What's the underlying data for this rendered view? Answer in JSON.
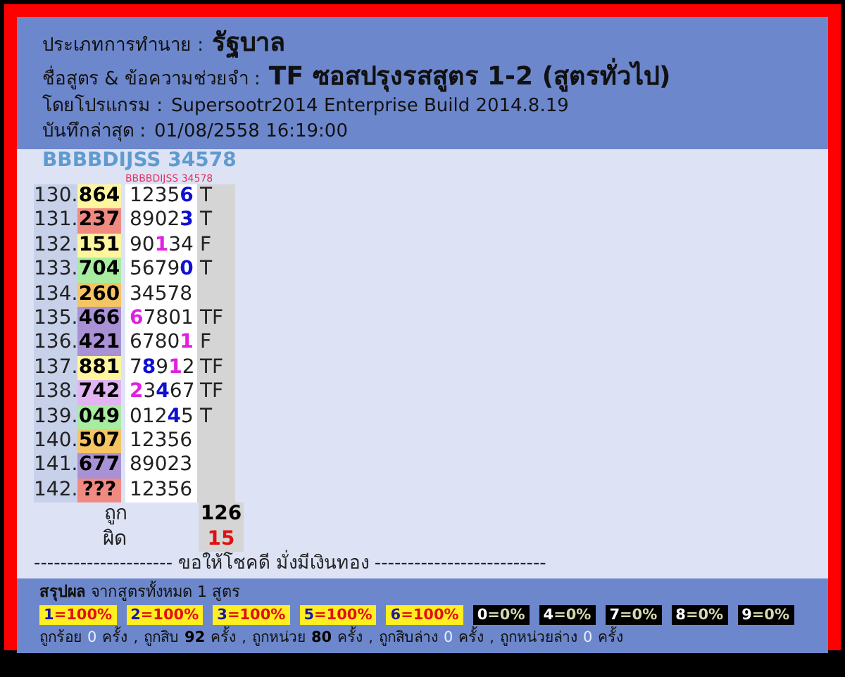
{
  "header": [
    {
      "label": "ประเภทการทำนาย :",
      "value": "รัฐบาล",
      "kind": "large"
    },
    {
      "label": "ชื่อสูตร & ข้อความช่วยจำ :",
      "value": "TF ซอสปรุงรสสูตร 1-2 (สูตรทั่วไป)",
      "kind": "large"
    },
    {
      "label": "โดยโปรแกรม :",
      "value": "Supersootr2014 Enterprise Build 2014.8.19",
      "kind": "plain"
    },
    {
      "label": "บันทึกล่าสุด :",
      "value": "01/08/2558 16:19:00",
      "kind": "plain"
    }
  ],
  "formula_title": "BBBBDIJSS 34578",
  "column_heading": "BBBBDIJSS 34578",
  "rows": [
    {
      "no": "130.",
      "result": "864",
      "color": "#fff59d",
      "digits": [
        {
          "text": "1235",
          "kind": "plain"
        },
        {
          "text": "6",
          "kind": "blue"
        }
      ],
      "verdict": "T"
    },
    {
      "no": "131.",
      "result": "237",
      "color": "#f08a80",
      "digits": [
        {
          "text": "8902",
          "kind": "plain"
        },
        {
          "text": "3",
          "kind": "blue"
        }
      ],
      "verdict": "T"
    },
    {
      "no": "132.",
      "result": "151",
      "color": "#fff59d",
      "digits": [
        {
          "text": "90",
          "kind": "plain"
        },
        {
          "text": "1",
          "kind": "pink"
        },
        {
          "text": "34",
          "kind": "plain"
        }
      ],
      "verdict": "F"
    },
    {
      "no": "133.",
      "result": "704",
      "color": "#a8eca0",
      "digits": [
        {
          "text": "5679",
          "kind": "plain"
        },
        {
          "text": "0",
          "kind": "blue"
        }
      ],
      "verdict": "T"
    },
    {
      "no": "134.",
      "result": "260",
      "color": "#f5c463",
      "digits": [
        {
          "text": "34578",
          "kind": "plain"
        }
      ]
    },
    {
      "no": "135.",
      "result": "466",
      "color": "#a891d4",
      "digits": [
        {
          "text": "6",
          "kind": "pink"
        },
        {
          "text": "7801",
          "kind": "plain"
        }
      ],
      "verdict": "TF"
    },
    {
      "no": "136.",
      "result": "421",
      "color": "#a891d4",
      "digits": [
        {
          "text": "6780",
          "kind": "plain"
        },
        {
          "text": "1",
          "kind": "pink"
        }
      ],
      "verdict": "F"
    },
    {
      "no": "137.",
      "result": "881",
      "color": "#fff59d",
      "digits": [
        {
          "text": "7",
          "kind": "plain"
        },
        {
          "text": "8",
          "kind": "blue"
        },
        {
          "text": "9",
          "kind": "plain"
        },
        {
          "text": "1",
          "kind": "pink"
        },
        {
          "text": "2",
          "kind": "plain"
        }
      ],
      "verdict": "TF"
    },
    {
      "no": "138.",
      "result": "742",
      "color": "#e2b4f2",
      "digits": [
        {
          "text": "2",
          "kind": "pink"
        },
        {
          "text": "3",
          "kind": "plain"
        },
        {
          "text": "4",
          "kind": "blue"
        },
        {
          "text": "67",
          "kind": "plain"
        }
      ],
      "verdict": "TF"
    },
    {
      "no": "139.",
      "result": "049",
      "color": "#a8eca0",
      "digits": [
        {
          "text": "012",
          "kind": "plain"
        },
        {
          "text": "4",
          "kind": "blue"
        },
        {
          "text": "5",
          "kind": "plain"
        }
      ],
      "verdict": "T"
    },
    {
      "no": "140.",
      "result": "507",
      "color": "#f5c463",
      "digits": [
        {
          "text": "12356",
          "kind": "plain"
        }
      ]
    },
    {
      "no": "141.",
      "result": "677",
      "color": "#a891d4",
      "digits": [
        {
          "text": "89023",
          "kind": "plain"
        }
      ]
    },
    {
      "no": "142.",
      "result": "???",
      "color": "#f08a80",
      "digits": [
        {
          "text": "12356",
          "kind": "plain"
        }
      ]
    }
  ],
  "totals": [
    {
      "label": "ถูก",
      "value": "126",
      "kind": "right"
    },
    {
      "label": "ผิด",
      "value": "15",
      "kind": "wrong"
    }
  ],
  "divider_text": "--------------------- ขอให้โชคดี มั่งมีเงินทอง --------------------------",
  "summary": "**สรุปผล** จากสูตรทั้งหมด 1 สูตร",
  "digit_stats": [
    {
      "digit": "1",
      "rate": "=100%",
      "kind": "hit"
    },
    {
      "digit": "2",
      "rate": "=100%",
      "kind": "hit"
    },
    {
      "digit": "3",
      "rate": "=100%",
      "kind": "hit"
    },
    {
      "digit": "5",
      "rate": "=100%",
      "kind": "hit"
    },
    {
      "digit": "6",
      "rate": "=100%",
      "kind": "hit"
    },
    {
      "digit": "0",
      "rate": "=0%",
      "kind": "miss"
    },
    {
      "digit": "4",
      "rate": "=0%",
      "kind": "miss"
    },
    {
      "digit": "7",
      "rate": "=0%",
      "kind": "miss"
    },
    {
      "digit": "8",
      "rate": "=0%",
      "kind": "miss"
    },
    {
      "digit": "9",
      "rate": "=0%",
      "kind": "miss"
    }
  ],
  "counts": [
    {
      "label": "ถูกร้อย",
      "count": "0",
      "unit": "ครั้ง",
      "kind": "faint"
    },
    {
      "sep": ",",
      "label": "ถูกสิบ",
      "count": "92",
      "unit": "ครั้ง",
      "kind": "strong"
    },
    {
      "sep": ",",
      "label": "ถูกหน่วย",
      "count": "80",
      "unit": "ครั้ง",
      "kind": "strong"
    },
    {
      "sep": ",",
      "label": "ถูกสิบล่าง",
      "count": "0",
      "unit": "ครั้ง",
      "kind": "faint"
    },
    {
      "sep": ",",
      "label": "ถูกหน่วยล่าง",
      "count": "0",
      "unit": "ครั้ง",
      "kind": "faint"
    }
  ]
}
